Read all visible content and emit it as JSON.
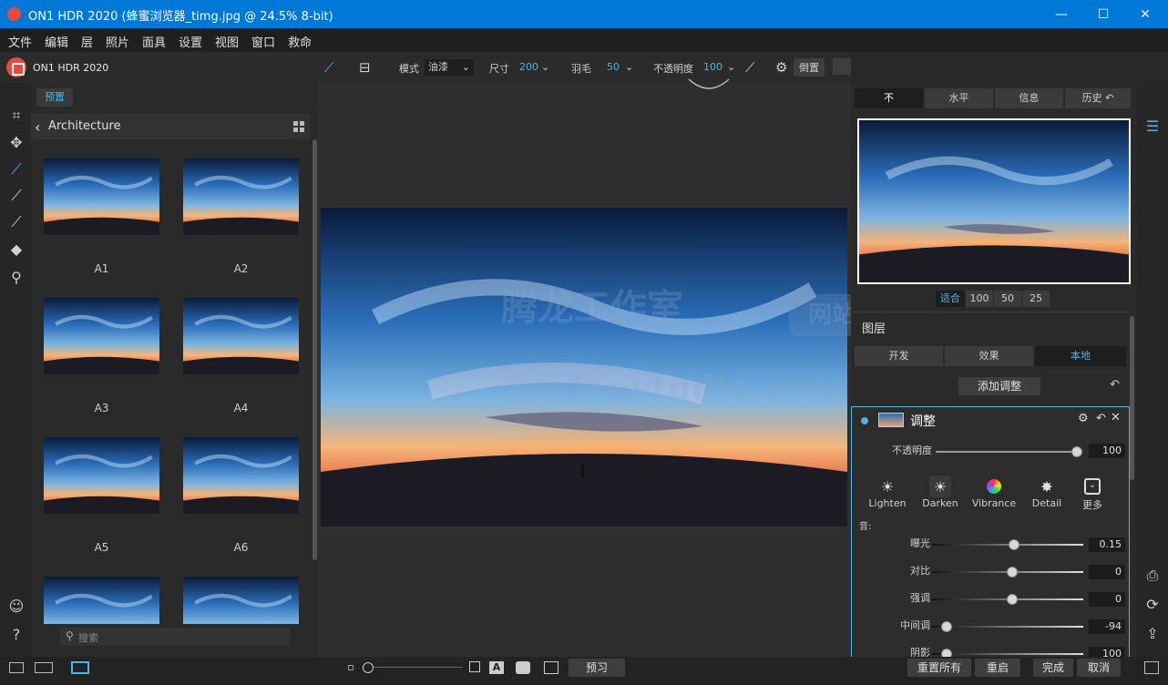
{
  "window": {
    "title": "ON1 HDR 2020 (蜂蜜浏览器_timg.jpg @ 24.5% 8-bit)",
    "minimize": "—",
    "maximize": "☐",
    "close": "✕"
  },
  "menu": [
    "文件",
    "编辑",
    "层",
    "照片",
    "面具",
    "设置",
    "视图",
    "窗口",
    "救命"
  ],
  "brand": {
    "name": "ON1 HDR 2020"
  },
  "browser": {
    "tab": "预置",
    "folder": "Architecture",
    "thumbnails": [
      {
        "label": "A1"
      },
      {
        "label": "A2"
      },
      {
        "label": "A3"
      },
      {
        "label": "A4"
      },
      {
        "label": "A5"
      },
      {
        "label": "A6"
      },
      {
        "label": ""
      },
      {
        "label": ""
      }
    ],
    "search_placeholder": "搜索"
  },
  "toolbar": {
    "mode_label": "模式",
    "mode_value": "油漆",
    "size_label": "尺寸",
    "size_value": "200",
    "feather_label": "羽毛",
    "feather_value": "50",
    "opacity_label": "不透明度",
    "opacity_value": "100",
    "invert_label": "倒置"
  },
  "right": {
    "tabs": [
      "不",
      "水平",
      "信息",
      "历史"
    ],
    "zoom": [
      "适合",
      "100",
      "50",
      "25"
    ],
    "layers_title": "图层",
    "bottom_tabs": [
      "开发",
      "效果",
      "本地"
    ],
    "add_adjustment": "添加调整",
    "adjust": {
      "title": "调整",
      "opacity_label": "不透明度",
      "opacity_value": "100",
      "effects": [
        "Lighten",
        "Darken",
        "Vibrance",
        "Detail",
        "更多"
      ],
      "tone_label": "音:",
      "sliders": [
        {
          "label": "曝光",
          "value": "0.15"
        },
        {
          "label": "对比",
          "value": "0"
        },
        {
          "label": "强调",
          "value": "0"
        },
        {
          "label": "中间调",
          "value": "-94"
        },
        {
          "label": "阴影",
          "value": "100"
        }
      ]
    }
  },
  "bottom": {
    "preview": "预习",
    "reset_all": "重置所有",
    "restart": "重启",
    "done": "完成",
    "cancel": "取消"
  },
  "watermark": {
    "line1": "腾龙工作室",
    "box": "网站",
    "line2": "Tenlonstudio.com"
  },
  "colors": {
    "accent": "#4fb4e6",
    "titlebar": "#0078d7",
    "brand": "#e64a3c"
  }
}
